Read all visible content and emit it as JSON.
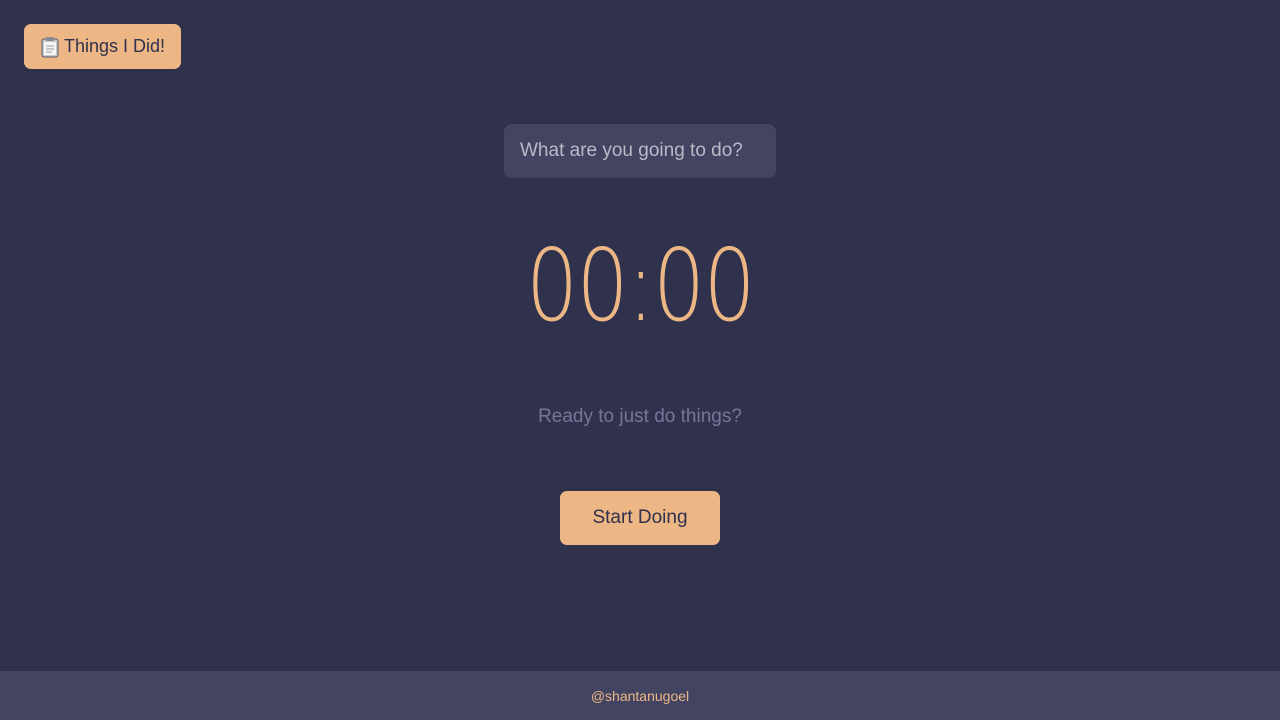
{
  "header": {
    "history_button": {
      "icon": "clipboard-icon",
      "label": "Things I Did!"
    }
  },
  "task_input": {
    "value": "",
    "placeholder": "What are you going to do?"
  },
  "timer": {
    "display": "00:00"
  },
  "status": {
    "text": "Ready to just do things?"
  },
  "actions": {
    "start_label": "Start Doing"
  },
  "footer": {
    "credit": "@shantanugoel"
  },
  "colors": {
    "background": "#2f314d",
    "surface": "#424462",
    "accent": "#ecb784",
    "muted_text": "#747799"
  }
}
